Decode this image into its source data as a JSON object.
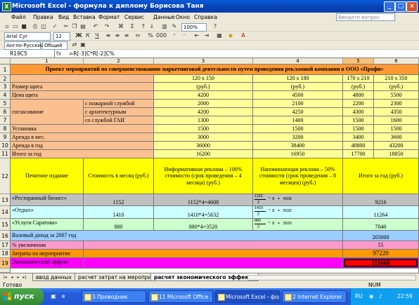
{
  "window": {
    "title": "Microsoft Excel - формула к диплому Борисова Таня",
    "app_icon": "X"
  },
  "menu": {
    "items": [
      "Файл",
      "Правка",
      "Вид",
      "Вставка",
      "Формат",
      "Сервис",
      "Данные",
      "Окно",
      "Справка"
    ],
    "help_placeholder": "Введите вопрос"
  },
  "toolbar": {
    "font_name": "Arial Cyr",
    "font_size": "12",
    "zoom": "100%",
    "lang": "Англо-Русский",
    "style": "Общий"
  },
  "formula_bar": {
    "cell_ref": "R19C5",
    "fx": "fx",
    "formula": "=R[-3]C*R[-2]C%"
  },
  "columns": [
    "1",
    "2",
    "3",
    "4",
    "5",
    "6"
  ],
  "rows": [
    "1",
    "2",
    "3",
    "4",
    "5",
    "6",
    "7",
    "8",
    "9",
    "10",
    "11",
    "12",
    "13",
    "14",
    "15",
    "16",
    "17",
    "18",
    "19"
  ],
  "table": {
    "title": "Проект мероприятий по совершенствованию маркетинговой деятельности путем проведения рекламной компании в ООО «Профи»",
    "sizes": [
      "120 х 150",
      "120 х 180",
      "170 х 210",
      "210 х 350"
    ],
    "size_label": "Размер щита",
    "units": "(руб.)",
    "price_label": "Цена  щита",
    "price": [
      "4200",
      "4500",
      "4800",
      "5500"
    ],
    "agree_label": "согласование",
    "agree_fire": "с пожарной службой",
    "agree_fire_v": [
      "2000",
      "2100",
      "2200",
      "2300"
    ],
    "agree_arch": "с архитектурным",
    "agree_arch_v": [
      "4200",
      "4250",
      "4300",
      "4350"
    ],
    "agree_gai": "со службой ГАИ",
    "agree_gai_v": [
      "1300",
      "1400",
      "1500",
      "1600"
    ],
    "install_label": "Установка",
    "install_v": [
      "1500",
      "1500",
      "1500",
      "1500"
    ],
    "rent_m_label": "Аренда в мес.",
    "rent_m_v": [
      "3000",
      "3200",
      "3400",
      "3600"
    ],
    "rent_y_label": "Аренда в год",
    "rent_y_v": [
      "36000",
      "38400",
      "40800",
      "43200"
    ],
    "total_y_label": "Итого за год",
    "total_y_v": [
      "16200",
      "16950",
      "17700",
      "18850"
    ],
    "hdr_print": "Печатное издание",
    "hdr_cost": "Стоимость в месяц (руб.)",
    "hdr_info": "Информативная реклама – 100% стоимости (срок проведения – 4 месяца) (руб.)",
    "hdr_remind": "Напоминающая реклама – 50% стоимости (срок проведения – 8 месяцев) (руб.)",
    "hdr_total": "Итого за год (руб.)",
    "pubs": [
      {
        "name": "«Ресторанный бизнес»",
        "cost": "1152",
        "info": "1152*4=4608",
        "num": "1152",
        "den": "2",
        "rest": "*  8   =   4608",
        "total": "9216"
      },
      {
        "name": "«Отдых»",
        "cost": "1410",
        "info": "1410*4=5632",
        "num": "1410",
        "den": "2",
        "rest": "*  8   =   5632",
        "total": "11264"
      },
      {
        "name": "«Услуги Саратова»",
        "cost": "880",
        "info": "880*4=3520",
        "num": "880",
        "den": "2",
        "rest": "*  8   =   3520",
        "total": "7040"
      }
    ],
    "gross_label": "Валовый доход за 2007 год",
    "gross_v": "203000",
    "incr_label": "% увеличения",
    "incr_v": "55",
    "cost_label": "Затраты на мероприятие",
    "cost_v": "97220",
    "effect_label": "Экономический эффект",
    "effect_v": "111660"
  },
  "sheets": {
    "tabs": [
      "ввод данных",
      "расчет затрат на мероприятие",
      "расчет экономического эффекта"
    ],
    "active": 2
  },
  "status": {
    "ready": "Готово",
    "num": "NUM"
  },
  "taskbar": {
    "start": "пуск",
    "tasks": [
      "3 Проводник",
      "11 Microsoft Office ...",
      "Microsoft Excel - форм...",
      "2 Internet Explorer"
    ],
    "lang": "RU",
    "clock": "22:59"
  },
  "colors": {
    "title_row": "#ff9933",
    "label_col": "#fac090",
    "sizes_row": "#ffff99",
    "header_yellow": "#ffff00",
    "pub1": "#c0c0c0",
    "pub2": "#ccffff",
    "pub3": "#ccffcc",
    "gross": "#99ccff",
    "incr": "#ff99cc",
    "cost": "#ff9900",
    "effect": "#ff00ff",
    "effect_value": "#ff0000"
  }
}
